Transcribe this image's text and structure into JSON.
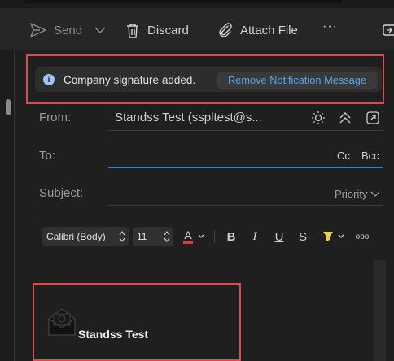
{
  "toolbar": {
    "send_label": "Send",
    "discard_label": "Discard",
    "attach_label": "Attach File",
    "more_label": "···"
  },
  "notification": {
    "message": "Company signature added.",
    "action_label": "Remove Notification Message",
    "info_glyph": "i"
  },
  "fields": {
    "from_label": "From:",
    "from_value": "Standss Test (sspltest@s...",
    "to_label": "To:",
    "cc_label": "Cc",
    "bcc_label": "Bcc",
    "subject_label": "Subject:",
    "priority_label": "Priority"
  },
  "format": {
    "font_name": "Calibri (Body)",
    "font_size": "11",
    "font_color_glyph": "A",
    "bold_glyph": "B",
    "italic_glyph": "I",
    "underline_glyph": "U",
    "strike_glyph": "S",
    "more_glyph": "ooo",
    "font_color": "#e53935",
    "highlight_color": "#f4d03f"
  },
  "body": {
    "signature_name": "Standss Test"
  },
  "colors": {
    "accent": "#3b7fc4",
    "link": "#5aa6ee",
    "annotation": "#e04a4a"
  }
}
